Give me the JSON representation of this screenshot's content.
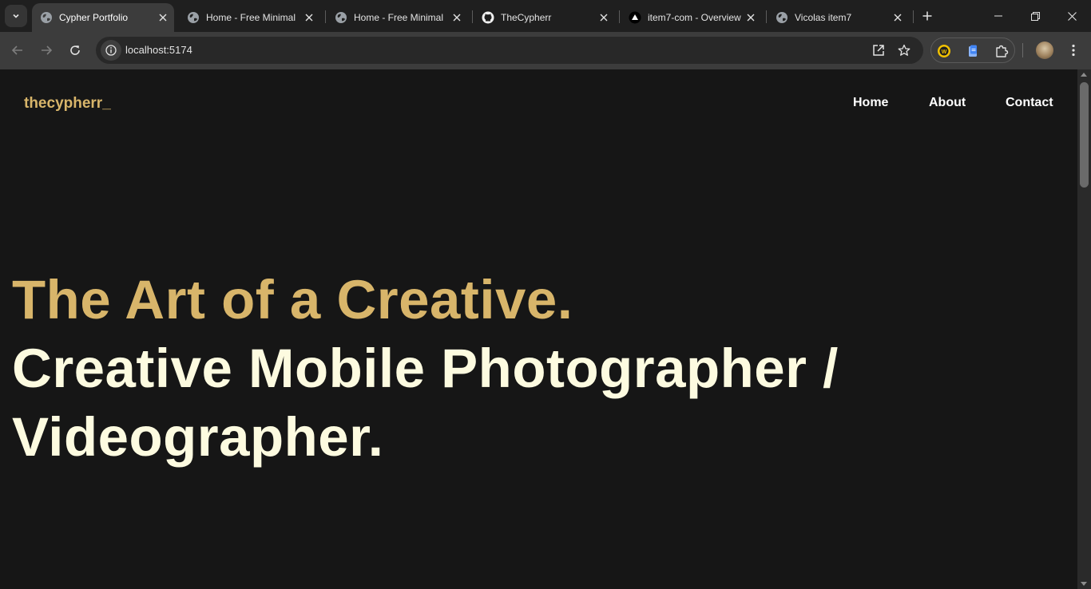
{
  "browser": {
    "tabs": [
      {
        "title": "Cypher Portfolio",
        "icon": "globe-icon",
        "active": true
      },
      {
        "title": "Home - Free Minimal",
        "icon": "globe-icon",
        "active": false
      },
      {
        "title": "Home - Free Minimal",
        "icon": "globe-icon",
        "active": false
      },
      {
        "title": "TheCypherr",
        "icon": "github-icon",
        "active": false
      },
      {
        "title": "item7-com - Overview",
        "icon": "vercel-icon",
        "active": false
      },
      {
        "title": "Vicolas item7",
        "icon": "globe-icon",
        "active": false
      }
    ],
    "url": "localhost:5174",
    "extensions": [
      "wallet-extension-icon",
      "docs-extension-icon",
      "puzzle-icon"
    ]
  },
  "page": {
    "logo": "thecypherr_",
    "nav": [
      "Home",
      "About",
      "Contact"
    ],
    "hero": {
      "accent": "The Art of a Creative.",
      "line2": "Creative Mobile Photographer /",
      "line3": "Videographer."
    }
  },
  "colors": {
    "accent": "#d8b56a",
    "hero_text": "#fdfbe0",
    "background": "#161616",
    "nav_text": "#ffffff"
  }
}
